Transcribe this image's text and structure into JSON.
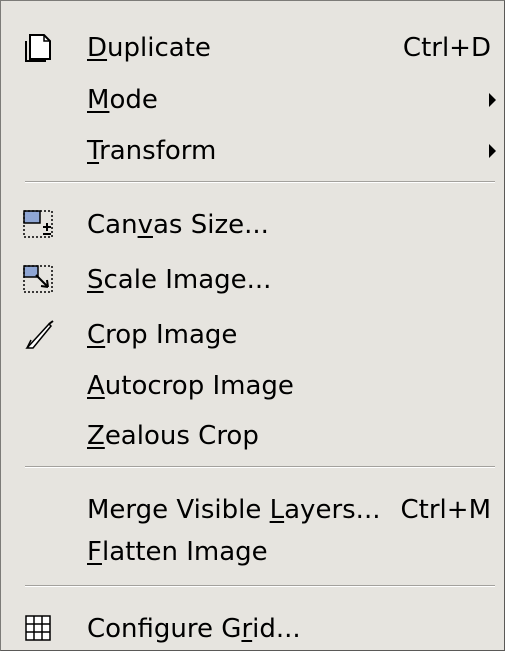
{
  "menu": {
    "duplicate": {
      "pre": "",
      "mn": "D",
      "post": "uplicate",
      "accel": "Ctrl+D",
      "icon": "duplicate-icon"
    },
    "mode": {
      "pre": "",
      "mn": "M",
      "post": "ode"
    },
    "transform": {
      "pre": "",
      "mn": "T",
      "post": "ransform"
    },
    "canvas_size": {
      "pre": "Can",
      "mn": "v",
      "post": "as Size...",
      "icon": "canvas-size-icon"
    },
    "scale_image": {
      "pre": "",
      "mn": "S",
      "post": "cale Image...",
      "icon": "scale-image-icon"
    },
    "crop_image": {
      "pre": "",
      "mn": "C",
      "post": "rop Image",
      "icon": "crop-knife-icon"
    },
    "autocrop_image": {
      "pre": "",
      "mn": "A",
      "post": "utocrop Image"
    },
    "zealous_crop": {
      "pre": "",
      "mn": "Z",
      "post": "ealous Crop"
    },
    "merge_visible_layers": {
      "pre": "Merge Visible ",
      "mn": "L",
      "post": "ayers...",
      "accel": "Ctrl+M"
    },
    "flatten_image": {
      "pre": "",
      "mn": "F",
      "post": "latten Image"
    },
    "configure_grid": {
      "pre": "Configure G",
      "mn": "r",
      "post": "id...",
      "icon": "grid-icon"
    }
  }
}
